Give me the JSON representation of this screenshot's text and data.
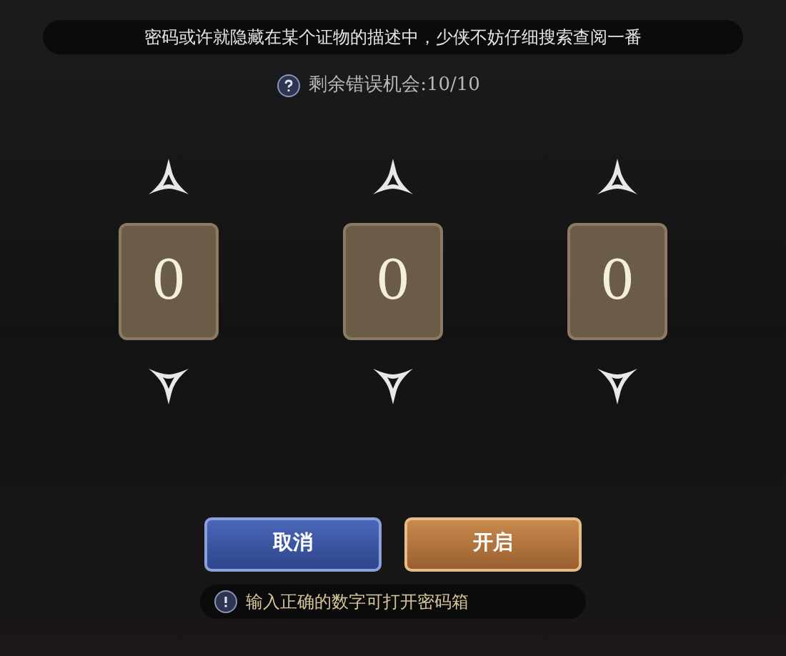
{
  "hint": "密码或许就隐藏在某个证物的描述中，少侠不妨仔细搜索查阅一番",
  "attempts": {
    "label": "剩余错误机会:",
    "value": "10/10"
  },
  "dials": [
    {
      "digit": "0"
    },
    {
      "digit": "0"
    },
    {
      "digit": "0"
    }
  ],
  "buttons": [
    {
      "label": "取消",
      "kind": "cancel"
    },
    {
      "label": "开启",
      "kind": "confirm"
    }
  ],
  "footer_note": "输入正确的数字可打开密码箱"
}
